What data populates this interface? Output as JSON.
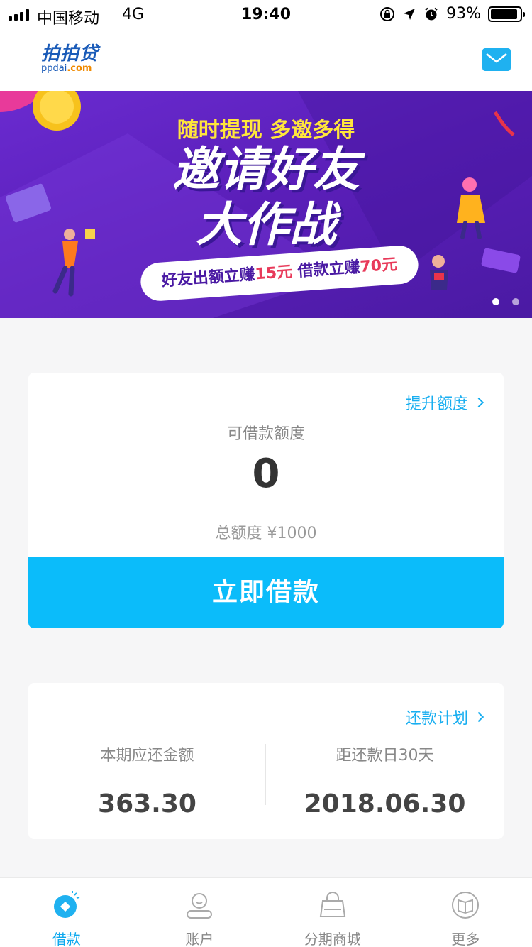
{
  "status_bar": {
    "carrier": "中国移动",
    "network": "4G",
    "time": "19:40",
    "battery_text": "93%",
    "battery_level": 0.93
  },
  "header": {
    "logo_cn": "拍拍贷",
    "logo_en_main": "ppdai",
    "logo_en_tld": ".com"
  },
  "banner": {
    "subtitle": "随时提现 多邀多得",
    "title_line1": "邀请好友",
    "title_line2": "大作战",
    "pill_a": "好友出额立赚",
    "pill_a_amount": "15元",
    "pill_b": " 借款立赚",
    "pill_b_amount": "70元",
    "slide_count": 2,
    "active_slide": 1
  },
  "credit": {
    "raise_label": "提升额度",
    "available_label": "可借款额度",
    "available_value": "0",
    "total_label": "总额度 ¥1000",
    "borrow_button": "立即借款"
  },
  "repay": {
    "plan_label": "还款计划",
    "due_label": "本期应还金额",
    "due_value": "363.30",
    "days_label": "距还款日30天",
    "date_value": "2018.06.30"
  },
  "tabs": [
    {
      "label": "借款",
      "icon": "loan-icon",
      "active": true
    },
    {
      "label": "账户",
      "icon": "account-icon",
      "active": false
    },
    {
      "label": "分期商城",
      "icon": "mall-icon",
      "active": false
    },
    {
      "label": "更多",
      "icon": "more-icon",
      "active": false
    }
  ],
  "colors": {
    "accent": "#0bbcfa",
    "link": "#18aef0",
    "banner_purple": "#5a1eb8",
    "banner_yellow": "#ffe63c",
    "highlight_red": "#e83a5a"
  }
}
